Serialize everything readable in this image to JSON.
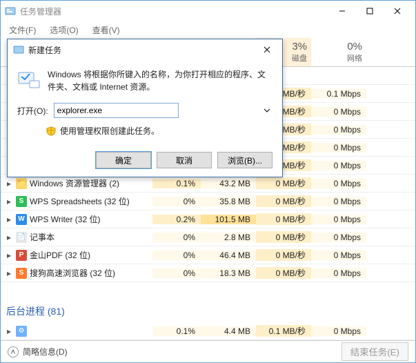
{
  "taskmgr": {
    "title": "任务管理器",
    "menu": {
      "file": "文件(F)",
      "options": "选项(O)",
      "view": "查看(V)"
    },
    "cols": {
      "disk": {
        "pct": "3%",
        "label": "磁盘"
      },
      "net": {
        "pct": "0%",
        "label": "网络"
      }
    },
    "rows": [
      {
        "name": "",
        "cpu": "",
        "mem": "",
        "disk": "",
        "net": "",
        "icon": ""
      },
      {
        "name": "",
        "cpu": "",
        "mem": "",
        "disk": "MB/秒",
        "net": "0.1 Mbps",
        "icon": ""
      },
      {
        "name": "",
        "cpu": "",
        "mem": "",
        "disk": "MB/秒",
        "net": "0 Mbps",
        "icon": ""
      },
      {
        "name": "",
        "cpu": "",
        "mem": "",
        "disk": "MB/秒",
        "net": "0 Mbps",
        "icon": ""
      },
      {
        "name": "",
        "cpu": "",
        "mem": "",
        "disk": "MB/秒",
        "net": "0 Mbps",
        "icon": ""
      },
      {
        "name": "",
        "cpu": "",
        "mem": "",
        "disk": "MB/秒",
        "net": "0 Mbps",
        "icon": ""
      },
      {
        "name": "Windows 资源管理器 (2)",
        "cpu": "0.1%",
        "mem": "43.2 MB",
        "disk": "0 MB/秒",
        "net": "0 Mbps",
        "icon": "folder"
      },
      {
        "name": "WPS Spreadsheets (32 位)",
        "cpu": "0%",
        "mem": "35.8 MB",
        "disk": "0 MB/秒",
        "net": "0 Mbps",
        "icon": "wps-s"
      },
      {
        "name": "WPS Writer (32 位)",
        "cpu": "0.2%",
        "mem": "101.5 MB",
        "disk": "0 MB/秒",
        "net": "0 Mbps",
        "icon": "wps-w"
      },
      {
        "name": "记事本",
        "cpu": "0%",
        "mem": "2.8 MB",
        "disk": "0 MB/秒",
        "net": "0 Mbps",
        "icon": "notepad"
      },
      {
        "name": "金山PDF (32 位)",
        "cpu": "0%",
        "mem": "46.4 MB",
        "disk": "0 MB/秒",
        "net": "0 Mbps",
        "icon": "pdf"
      },
      {
        "name": "搜狗高速浏览器 (32 位)",
        "cpu": "0%",
        "mem": "18.3 MB",
        "disk": "0 MB/秒",
        "net": "0 Mbps",
        "icon": "sogou"
      }
    ],
    "group": "后台进程 (81)",
    "bg_row": {
      "name": "",
      "cpu": "0.1%",
      "mem": "4.4 MB",
      "disk": "0.1 MB/秒",
      "net": "0 Mbps"
    },
    "footer": {
      "brief": "简略信息(D)",
      "endtask": "结束任务(E)"
    }
  },
  "dialog": {
    "title": "新建任务",
    "msg": "Windows 将根据你所键入的名称，为你打开相应的程序、文件夹、文档或 Internet 资源。",
    "open_label": "打开(O):",
    "open_value": "explorer.exe",
    "admin": "使用管理权限创建此任务。",
    "ok": "确定",
    "cancel": "取消",
    "browse": "浏览(B)..."
  },
  "icons": {
    "folder": {
      "bg": "#ffd66b",
      "glyph": "📁"
    },
    "wps-s": {
      "bg": "#2dbd5a",
      "glyph": "S"
    },
    "wps-w": {
      "bg": "#2d8cf0",
      "glyph": "W"
    },
    "notepad": {
      "bg": "#e8e8e8",
      "glyph": "📄"
    },
    "pdf": {
      "bg": "#d54d3a",
      "glyph": "P"
    },
    "sogou": {
      "bg": "#ff7a2e",
      "glyph": "S"
    },
    "gear": {
      "bg": "#6fb3ff",
      "glyph": "⚙"
    }
  }
}
